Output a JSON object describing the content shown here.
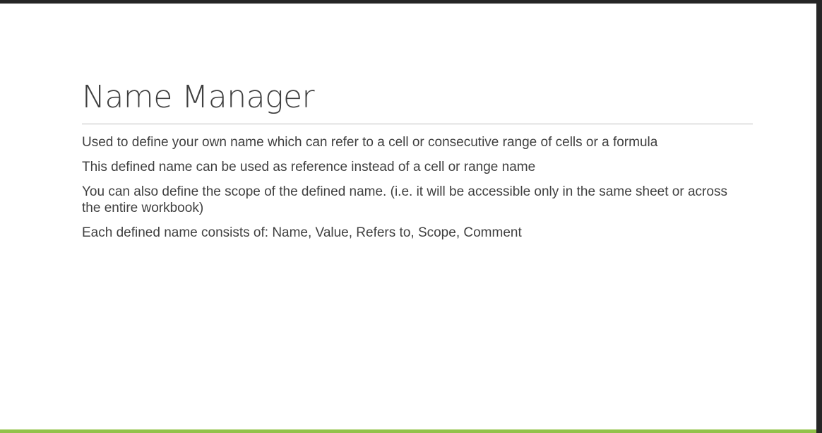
{
  "slide": {
    "title": "Name Manager",
    "bullets": [
      "Used to define your own name which can refer to a cell or consecutive range of cells or a formula",
      "This defined name can be used as reference instead of a cell or range name",
      "You can also define the scope of the defined name. (i.e. it will be accessible only in the same sheet or across the entire workbook)",
      "Each defined name consists of: Name, Value, Refers to, Scope, Comment"
    ],
    "accent_color": "#92c24a"
  }
}
